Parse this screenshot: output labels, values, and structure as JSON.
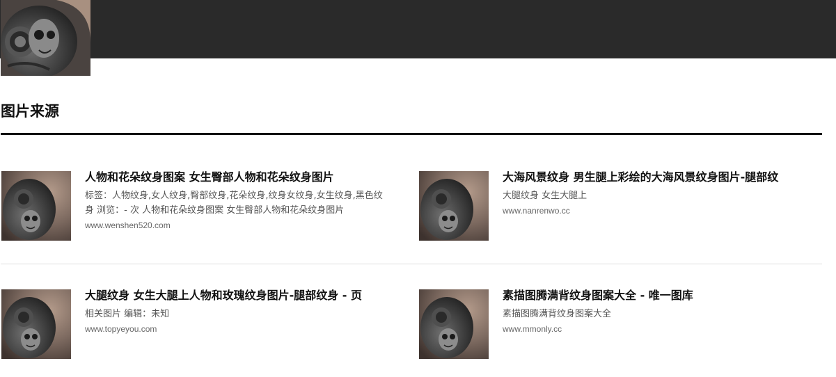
{
  "section": {
    "title": "图片来源"
  },
  "results": [
    {
      "title": "人物和花朵纹身图案 女生臀部人物和花朵纹身图片",
      "description": "标签：人物纹身,女人纹身,臀部纹身,花朵纹身,纹身女纹身,女生纹身,黑色纹身 浏览：- 次 人物和花朵纹身图案 女生臀部人物和花朵纹身图片",
      "domain": "www.wenshen520.com"
    },
    {
      "title": "大海风景纹身 男生腿上彩绘的大海风景纹身图片-腿部纹",
      "description": "大腿纹身 女生大腿上",
      "domain": "www.nanrenwo.cc"
    },
    {
      "title": "大腿纹身 女生大腿上人物和玫瑰纹身图片-腿部纹身 - 页",
      "description": "相关图片 编辑：未知",
      "domain": "www.topyeyou.com"
    },
    {
      "title": "素描图腾满背纹身图案大全 - 唯一图库",
      "description": "素描图腾满背纹身图案大全",
      "domain": "www.mmonly.cc"
    }
  ]
}
